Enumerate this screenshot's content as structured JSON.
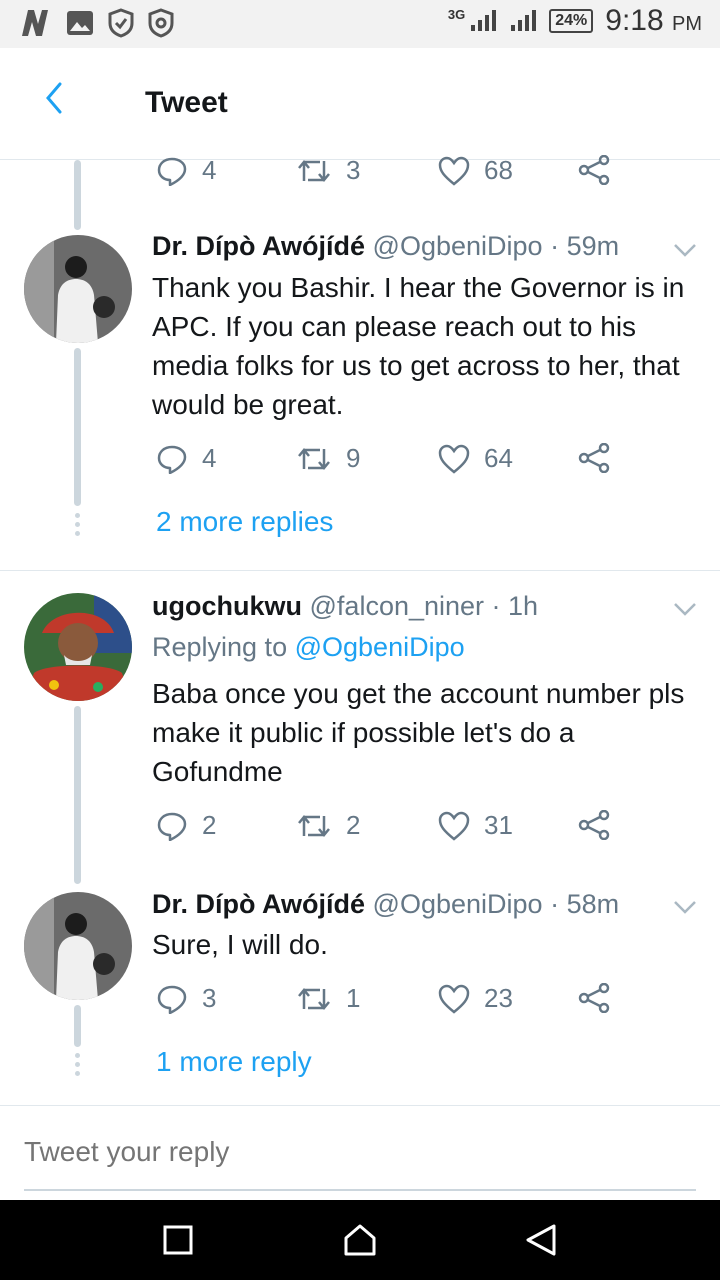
{
  "status_bar": {
    "network": "3G",
    "battery": "24%",
    "time": "9:18",
    "ampm": "PM"
  },
  "header": {
    "title": "Tweet"
  },
  "top_actions": {
    "replies": "4",
    "retweets": "3",
    "likes": "68"
  },
  "tweets": [
    {
      "name": "Dr. Dípò Awójídé",
      "handle": "@OgbeniDipo",
      "time": "· 59m",
      "text": "Thank you Bashir. I hear the Governor is in APC. If you can please reach out to his media folks for us to get across to her, that would be great.",
      "replies": "4",
      "retweets": "9",
      "likes": "64"
    },
    {
      "name": "ugochukwu",
      "handle": "@falcon_niner",
      "time": "· 1h",
      "replying_label": "Replying to",
      "replying_handle": "@OgbeniDipo",
      "text": "Baba once you get the account number pls make it public if possible let's do a Gofundme",
      "replies": "2",
      "retweets": "2",
      "likes": "31"
    },
    {
      "name": "Dr. Dípò Awójídé",
      "handle": "@OgbeniDipo",
      "time": "· 58m",
      "text": "Sure, I will do.",
      "replies": "3",
      "retweets": "1",
      "likes": "23"
    }
  ],
  "more_replies_1": "2 more replies",
  "more_replies_2": "1 more reply",
  "reply_bar": {
    "placeholder": "Tweet your reply"
  },
  "colors": {
    "accent": "#1da1f2",
    "muted": "#657786",
    "line": "#ccd6dd"
  }
}
